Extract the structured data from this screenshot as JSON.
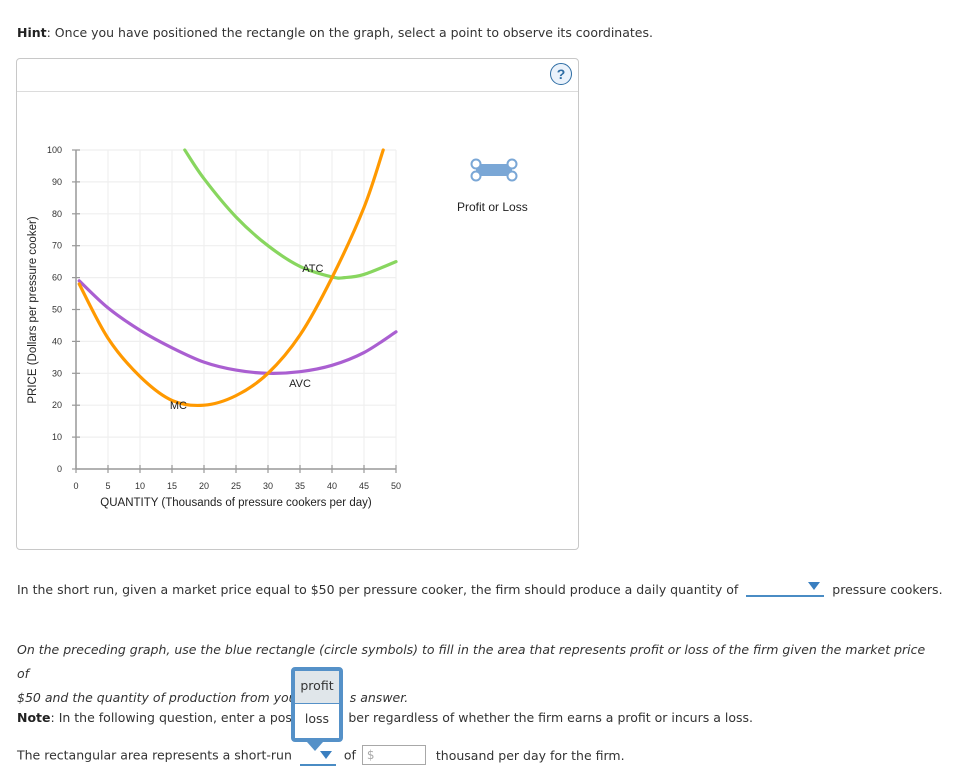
{
  "hint": {
    "label": "Hint",
    "text": ": Once you have positioned the rectangle on the graph, select a point to observe its coordinates."
  },
  "panel": {
    "help_icon": "question-mark-icon",
    "help_label": "?",
    "tool": {
      "icon": "rectangle-with-circle-handles-icon",
      "label": "Profit or Loss",
      "color": "#7aa7d6"
    }
  },
  "chart_data": {
    "type": "line",
    "title": "",
    "xlabel": "QUANTITY (Thousands of pressure cookers per day)",
    "ylabel": "PRICE (Dollars per pressure cooker)",
    "xlim": [
      0,
      50
    ],
    "ylim": [
      0,
      100
    ],
    "x_ticks": [
      0,
      5,
      10,
      15,
      20,
      25,
      30,
      35,
      40,
      45,
      50
    ],
    "y_ticks": [
      0,
      10,
      20,
      30,
      40,
      50,
      60,
      70,
      80,
      90,
      100
    ],
    "grid": true,
    "series": [
      {
        "name": "MC",
        "color": "#ff9900",
        "points": [
          [
            0.5,
            58
          ],
          [
            5,
            41
          ],
          [
            10,
            29
          ],
          [
            15,
            21.5
          ],
          [
            20,
            20
          ],
          [
            25,
            23
          ],
          [
            30,
            30
          ],
          [
            35,
            42
          ],
          [
            40,
            60
          ],
          [
            45,
            82
          ],
          [
            48,
            100
          ]
        ],
        "label_at": [
          16,
          20
        ]
      },
      {
        "name": "AVC",
        "color": "#aa5fd1",
        "points": [
          [
            0.5,
            59
          ],
          [
            5,
            50.5
          ],
          [
            10,
            43.5
          ],
          [
            15,
            38
          ],
          [
            20,
            33.5
          ],
          [
            25,
            31
          ],
          [
            30,
            30
          ],
          [
            35,
            30.5
          ],
          [
            40,
            32.5
          ],
          [
            45,
            36.5
          ],
          [
            50,
            43
          ]
        ],
        "label_at": [
          35,
          27
        ]
      },
      {
        "name": "ATC",
        "color": "#88d65f",
        "points": [
          [
            17,
            100
          ],
          [
            20,
            91
          ],
          [
            25,
            79
          ],
          [
            30,
            70
          ],
          [
            35,
            63.5
          ],
          [
            40,
            60.2
          ],
          [
            42,
            60
          ],
          [
            45,
            61
          ],
          [
            50,
            65
          ]
        ],
        "label_at": [
          37,
          63
        ]
      }
    ]
  },
  "question1": {
    "text_before": "In the short run, given a market price equal to $50 per pressure cooker, the firm should produce a daily quantity of",
    "dropdown_value": "",
    "text_after": "pressure cookers."
  },
  "question2": {
    "text_line1": "On the preceding graph, use the blue rectangle (circle symbols) to fill in the area that represents profit or loss of the firm given the market price of",
    "text_line2_before": "$50 and the quantity of production from your",
    "text_line2_after": "s answer."
  },
  "note": {
    "label": "Note",
    "text_before": ": In the following question, enter a posit",
    "text_after": "ber regardless of whether the firm earns a profit or incurs a loss."
  },
  "question3": {
    "text_before": "The rectangular area represents a short-run",
    "dropdown_value": "",
    "dropdown_options": [
      "profit",
      "loss"
    ],
    "highlighted_option": "profit",
    "text_of": "of",
    "input_placeholder": "$",
    "input_value": "",
    "text_after": "thousand per day for the firm."
  }
}
